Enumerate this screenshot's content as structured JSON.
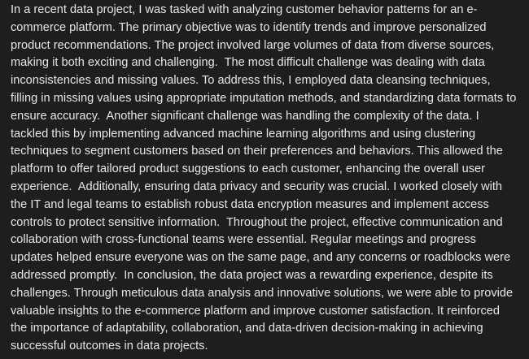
{
  "message": {
    "text": "In a recent data project, I was tasked with analyzing customer behavior patterns for an e-commerce platform. The primary objective was to identify trends and improve personalized product recommendations. The project involved large volumes of data from diverse sources, making it both exciting and challenging.  The most difficult challenge was dealing with data inconsistencies and missing values. To address this, I employed data cleansing techniques, filling in missing values using appropriate imputation methods, and standardizing data formats to ensure accuracy.  Another significant challenge was handling the complexity of the data. I tackled this by implementing advanced machine learning algorithms and using clustering techniques to segment customers based on their preferences and behaviors. This allowed the platform to offer tailored product suggestions to each customer, enhancing the overall user experience.  Additionally, ensuring data privacy and security was crucial. I worked closely with the IT and legal teams to establish robust data encryption measures and implement access controls to protect sensitive information.  Throughout the project, effective communication and collaboration with cross-functional teams were essential. Regular meetings and progress updates helped ensure everyone was on the same page, and any concerns or roadblocks were addressed promptly.  In conclusion, the data project was a rewarding experience, despite its challenges. Through meticulous data analysis and innovative solutions, we were able to provide valuable insights to the e-commerce platform and improve customer satisfaction. It reinforced the importance of adaptability, collaboration, and data-driven decision-making in achieving successful outcomes in data projects."
  }
}
